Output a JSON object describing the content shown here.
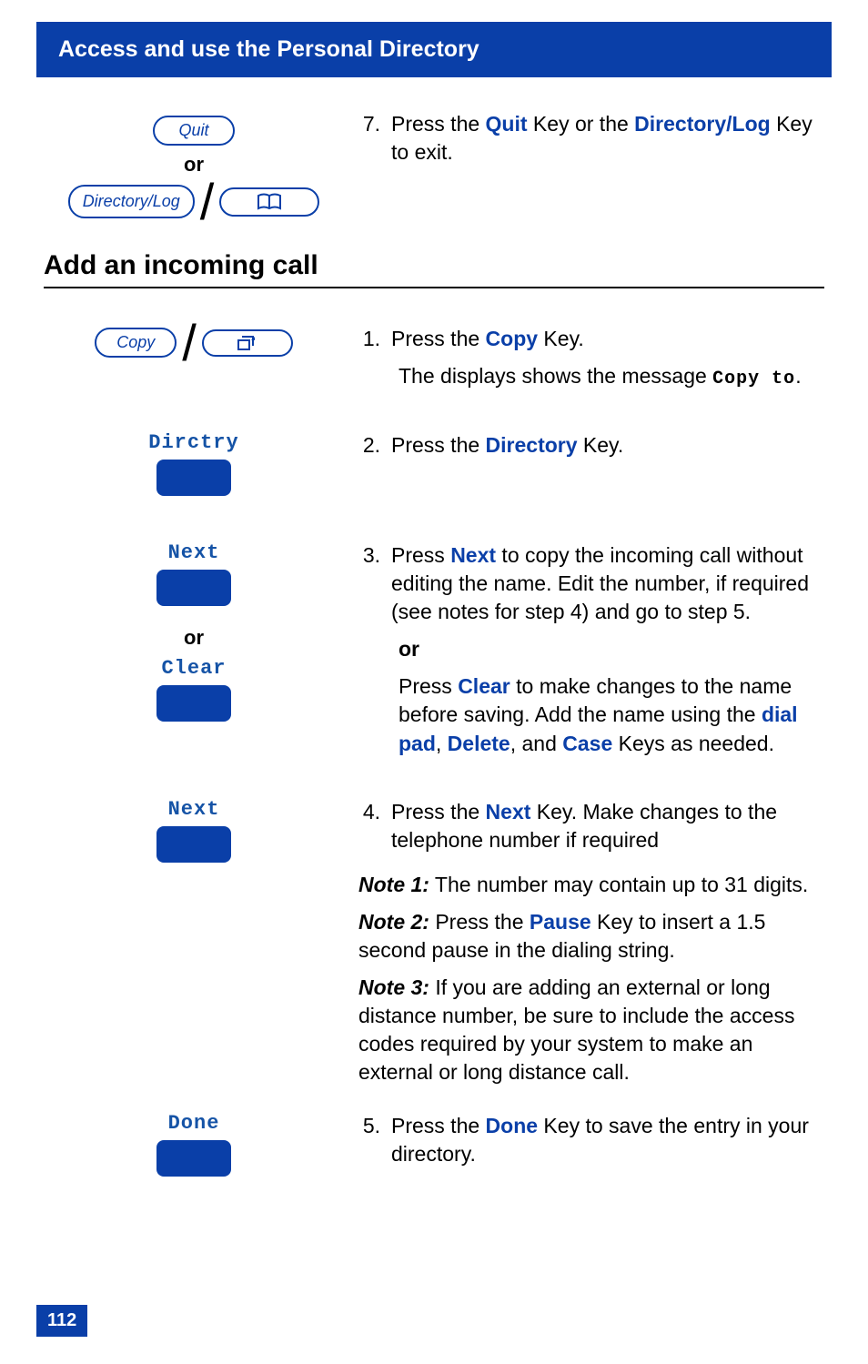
{
  "header": {
    "title": "Access and use the Personal Directory"
  },
  "step7": {
    "num": "7.",
    "text_before": "Press  the ",
    "key1": "Quit",
    "mid": " Key or the ",
    "key2": "Directory/Log",
    "text_after": " Key to exit.",
    "quit_btn": "Quit",
    "or": "or",
    "dirlog_btn": "Directory/Log"
  },
  "section_title": "Add an incoming call",
  "step1": {
    "num": "1.",
    "line1_pre": "Press the ",
    "key": "Copy",
    "line1_post": " Key.",
    "line2": "The displays shows the message ",
    "lcd": "Copy to",
    "dot": ".",
    "copy_btn": "Copy"
  },
  "step2": {
    "num": "2.",
    "pre": "Press the ",
    "key": "Directory",
    "post": " Key.",
    "lcd": "Dirctry"
  },
  "step3": {
    "num": "3.",
    "pre": "Press ",
    "key1": "Next",
    "mid1": " to copy the incoming call without editing the name. Edit the number, if required (see notes for step 4) and go to step 5.",
    "or_r": "or",
    "pre2": "Press ",
    "key2": "Clear",
    "mid2": " to make changes to the name before saving. Add the name using the ",
    "kp": "dial pad",
    "c1": ", ",
    "kd": "Delete",
    "c2": ", and ",
    "kc": "Case",
    "post2": " Keys as needed.",
    "lcd_next": "Next",
    "or_l": "or",
    "lcd_clear": "Clear"
  },
  "step4": {
    "num": "4.",
    "pre": "Press the ",
    "key": "Next",
    "post": " Key. Make changes to the telephone number if required",
    "lcd": "Next",
    "notes": {
      "n1l": "Note 1:",
      "n1t": "   The number may contain up to 31 digits.",
      "n2l": "Note 2:",
      "n2t_a": "   Press the ",
      "n2key": "Pause",
      "n2t_b": " Key to insert a 1.5 second pause in the dialing string.",
      "n3l": "Note 3:",
      "n3t": "   If you are adding an external or long distance number, be sure to include the access codes required by your system to make an external or long distance call."
    }
  },
  "step5": {
    "num": "5.",
    "pre": "Press the ",
    "key": "Done",
    "post": " Key to save the entry in your directory.",
    "lcd": "Done"
  },
  "page_number": "112"
}
